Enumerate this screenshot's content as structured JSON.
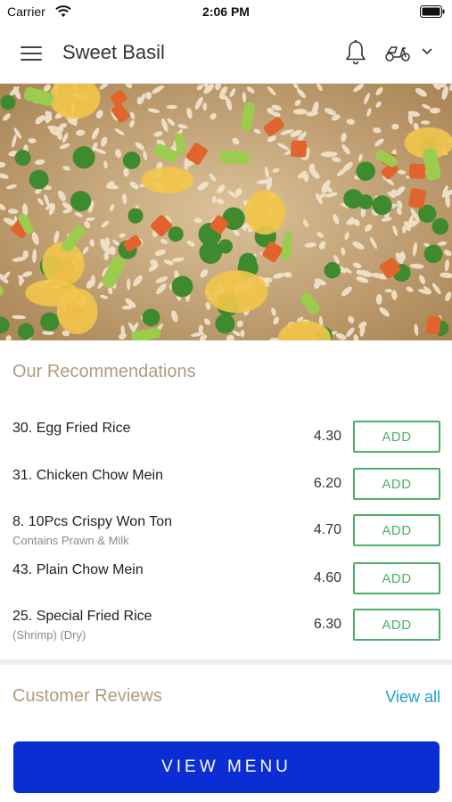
{
  "status_bar": {
    "carrier": "Carrier",
    "time": "2:06 PM"
  },
  "header": {
    "title": "Sweet Basil",
    "icons": [
      "menu-icon",
      "bell-icon",
      "scooter-icon",
      "chevron-down-icon"
    ]
  },
  "hero": {
    "description_icon": "fried-rice-photo"
  },
  "recommendations": {
    "title": "Our Recommendations",
    "add_label": "ADD",
    "items": [
      {
        "name": "30. Egg Fried Rice",
        "description": "",
        "price": "4.30"
      },
      {
        "name": "31. Chicken Chow Mein",
        "description": "",
        "price": "6.20"
      },
      {
        "name": "8. 10Pcs Crispy Won Ton",
        "description": "Contains Prawn & Milk",
        "price": "4.70"
      },
      {
        "name": "43. Plain Chow Mein",
        "description": "",
        "price": "4.60"
      },
      {
        "name": "25. Special Fried Rice",
        "description": "(Shrimp) (Dry)",
        "price": "6.30"
      }
    ]
  },
  "reviews": {
    "title": "Customer Reviews",
    "view_all": "View all"
  },
  "footer": {
    "view_menu": "VIEW MENU"
  },
  "colors": {
    "accent_green": "#4caf6a",
    "primary_blue": "#0a2ed4",
    "link_blue": "#1f9ed0",
    "section_title": "#b09b7f"
  }
}
